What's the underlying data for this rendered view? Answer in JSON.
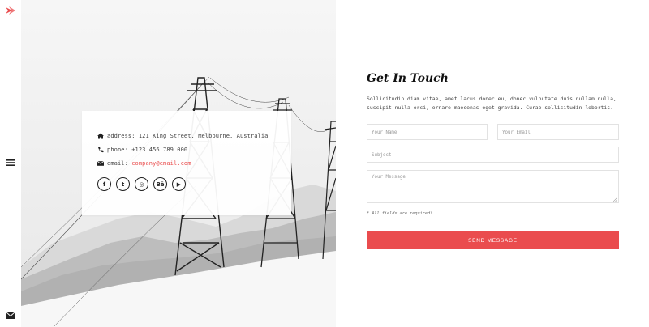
{
  "colors": {
    "accent": "#ea4c4e",
    "text": "#333333"
  },
  "sidebar": {
    "logo_icon": "bird-logo-icon",
    "menu_icon": "hamburger-icon",
    "mail_icon": "envelope-icon"
  },
  "hero": {
    "image": "power-line-towers-snowy-mountains"
  },
  "contact_card": {
    "address_label": "address:",
    "address_value": "121 King Street, Melbourne, Australia",
    "phone_label": "phone:",
    "phone_value": "+123 456 789 000",
    "email_label": "email:",
    "email_value": "company@email.com",
    "socials": [
      {
        "icon": "facebook-icon",
        "glyph": "f"
      },
      {
        "icon": "twitter-icon",
        "glyph": "t"
      },
      {
        "icon": "dribbble-icon",
        "glyph": "◎"
      },
      {
        "icon": "behance-icon",
        "glyph": "Bē"
      },
      {
        "icon": "youtube-icon",
        "glyph": "▶"
      }
    ]
  },
  "form": {
    "title": "Get In Touch",
    "description": "Sollicitudin diam vitae, amet lacus donec eu, donec vulputate duis nullam nulla, suscipit nulla orci, ornare maecenas eget gravida. Curae sollicitudin lobortis.",
    "name_placeholder": "Your Name",
    "email_placeholder": "Your Email",
    "subject_placeholder": "Subject",
    "message_placeholder": "Your Message",
    "required_note": "* All fields are required!",
    "submit_label": "SEND MESSAGE"
  }
}
